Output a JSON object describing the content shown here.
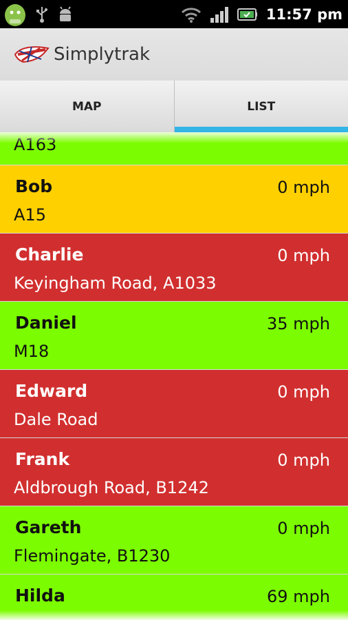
{
  "status_bar": {
    "time": "11:57 pm",
    "icons": [
      "android-icon",
      "usb-icon",
      "debug-icon",
      "wifi-icon",
      "signal-icon",
      "battery-icon"
    ]
  },
  "action_bar": {
    "title": "Simplytrak",
    "logo_icon": "union-jack-wing-icon"
  },
  "tabs": [
    {
      "label": "MAP",
      "active": false
    },
    {
      "label": "LIST",
      "active": true
    }
  ],
  "colors": {
    "moving": "#7cfc00",
    "warning": "#ffd000",
    "stopped": "#d12f2f",
    "tab_indicator": "#33b5e5"
  },
  "list": {
    "partial_row": {
      "road": "A163",
      "status": "green"
    },
    "rows": [
      {
        "name": "Bob",
        "speed": "0 mph",
        "road": "A15",
        "status": "yellow"
      },
      {
        "name": "Charlie",
        "speed": "0 mph",
        "road": "Keyingham Road, A1033",
        "status": "red"
      },
      {
        "name": "Daniel",
        "speed": "35 mph",
        "road": "M18",
        "status": "green"
      },
      {
        "name": "Edward",
        "speed": "0 mph",
        "road": "Dale Road",
        "status": "red"
      },
      {
        "name": "Frank",
        "speed": "0 mph",
        "road": "Aldbrough Road, B1242",
        "status": "red"
      },
      {
        "name": "Gareth",
        "speed": "0 mph",
        "road": "Flemingate, B1230",
        "status": "green"
      },
      {
        "name": "Hilda",
        "speed": "69 mph",
        "road": "",
        "status": "green"
      }
    ]
  }
}
